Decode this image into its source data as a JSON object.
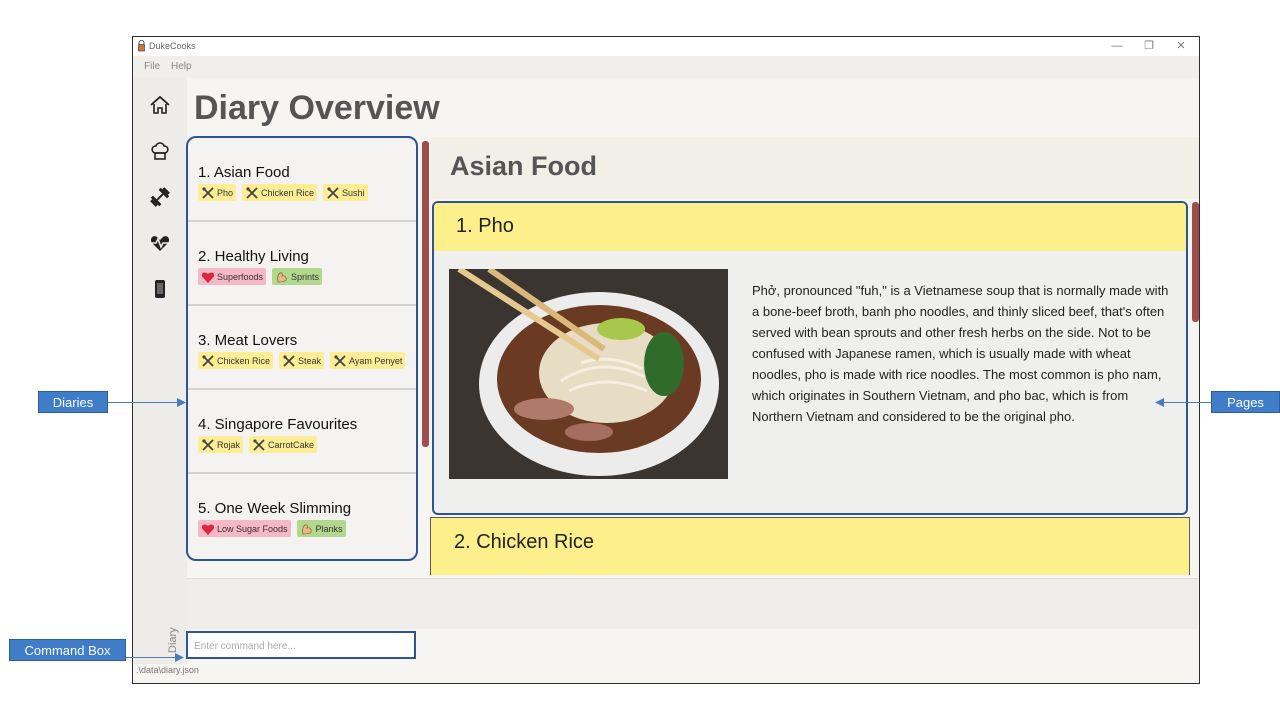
{
  "window": {
    "title": "DukeCooks",
    "controls": [
      "—",
      "❐",
      "✕"
    ],
    "menu": [
      "File",
      "Help"
    ]
  },
  "sidebar": {
    "icons": [
      "home-icon",
      "chef-hat-icon",
      "dumbbell-icon",
      "heartbeat-icon",
      "phone-icon"
    ],
    "label": "Diary"
  },
  "heading": "Diary Overview",
  "diaries": [
    {
      "title": "1.  Asian Food",
      "tags": [
        {
          "label": "Pho",
          "kind": "food"
        },
        {
          "label": "Chicken Rice",
          "kind": "food"
        },
        {
          "label": "Sushi",
          "kind": "food"
        }
      ]
    },
    {
      "title": "2.  Healthy Living",
      "tags": [
        {
          "label": "Superfoods",
          "kind": "pink"
        },
        {
          "label": "Sprints",
          "kind": "green"
        }
      ]
    },
    {
      "title": "3.  Meat Lovers",
      "tags": [
        {
          "label": "Chicken Rice",
          "kind": "food"
        },
        {
          "label": "Steak",
          "kind": "food"
        },
        {
          "label": "Ayam Penyet",
          "kind": "food"
        }
      ]
    },
    {
      "title": "4.  Singapore Favourites",
      "tags": [
        {
          "label": "Rojak",
          "kind": "food"
        },
        {
          "label": "CarrotCake",
          "kind": "food"
        }
      ]
    },
    {
      "title": "5.  One Week Slimming",
      "tags": [
        {
          "label": "Low Sugar Foods",
          "kind": "pink"
        },
        {
          "label": "Planks",
          "kind": "green"
        }
      ]
    }
  ],
  "pane": {
    "title": "Asian Food",
    "pages": [
      {
        "title": "1. Pho",
        "description": "Phở, pronounced \"fuh,\" is a Vietnamese soup that is normally made with a bone-beef broth, banh pho noodles, and thinly sliced beef, that's often served with bean sprouts and other fresh herbs on the side. Not to be confused with Japanese ramen, which is usually made with wheat noodles, pho is made with rice noodles. The most common is pho nam, which originates in Southern Vietnam, and pho bac, which is from Northern Vietnam and considered to be the original pho."
      },
      {
        "title": "2. Chicken Rice"
      }
    ]
  },
  "command": {
    "placeholder": "Enter command here..."
  },
  "status": {
    "path": ".\\data\\diary.json"
  },
  "callouts": {
    "diaries": "Diaries",
    "pages": "Pages",
    "command_box": "Command Box"
  },
  "colors": {
    "accent": "#2e5593",
    "page_bar": "#fdf08c",
    "scrollbar": "#9e4d4d",
    "callout": "#3f7dc9"
  }
}
